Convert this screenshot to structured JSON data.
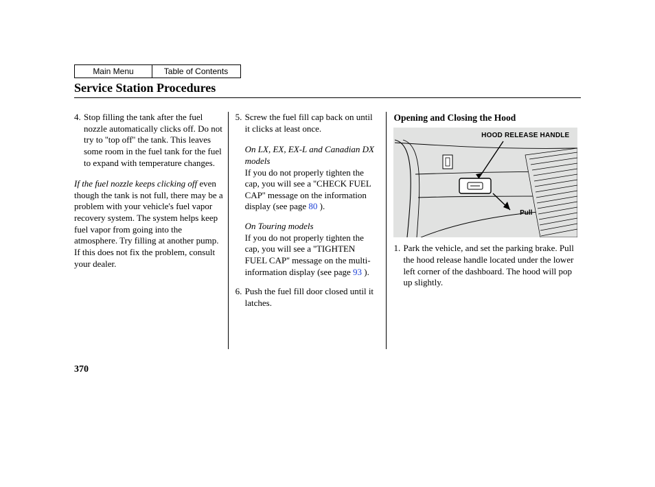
{
  "nav": {
    "main_menu": "Main Menu",
    "toc": "Table of Contents"
  },
  "title": "Service Station Procedures",
  "col1": {
    "step4_num": "4.",
    "step4": "Stop filling the tank after the fuel nozzle automatically clicks off. Do not try to ''top off'' the tank. This leaves some room in the fuel tank for the fuel to expand with temperature changes.",
    "note_lead": "If the fuel nozzle keeps clicking off",
    "note_rest": " even though the tank is not full, there may be a problem with your vehicle's fuel vapor recovery system. The system helps keep fuel vapor from going into the atmosphere. Try filling at another pump. If this does not fix the problem, consult your dealer."
  },
  "col2": {
    "step5_num": "5.",
    "step5": "Screw the fuel fill cap back on until it clicks at least once.",
    "variant1_label": "On LX, EX, EX-L and Canadian DX models",
    "variant1_text_a": "If you do not properly tighten the cap, you will see a ''CHECK FUEL CAP'' message on the information display (see page ",
    "variant1_page": "80",
    "variant1_text_b": " ).",
    "variant2_label": "On Touring models",
    "variant2_text_a": "If you do not properly tighten the cap, you will see a ''TIGHTEN FUEL CAP'' message on the multi-information display (see page  ",
    "variant2_page": "93",
    "variant2_text_b": "  ).",
    "step6_num": "6.",
    "step6": "Push the fuel fill door closed until it latches."
  },
  "col3": {
    "subhead": "Opening and Closing the Hood",
    "fig_label": "HOOD RELEASE HANDLE",
    "fig_pull": "Pull",
    "step1_num": "1.",
    "step1": "Park the vehicle, and set the parking brake. Pull the hood release handle located under the lower left corner of the dashboard. The hood will pop up slightly."
  },
  "page_number": "370"
}
